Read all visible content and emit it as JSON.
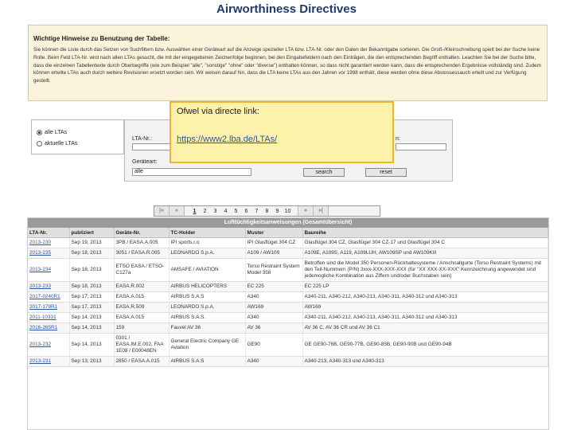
{
  "page": {
    "title": "Airworthiness Directives"
  },
  "hints": {
    "heading": "Wichtige Hinweise zu Benutzung der Tabelle:",
    "text": "Sie können die Liste durch das Setzen von Suchfiltern bzw. Auswählen einer Geräteart auf die Anzeige spezieller LTA bzw. LTA-Nr. oder den Daten der Bekanntgabe sortieren. Die Groß-/Kleinschreibung spielt bei der Suche keine Rolle. Beim Feld LTA-Nr. wird nach allen LTAs gesucht, die mit der eingegebenen Zeichenfolge beginnen, bei den Eingabefeldern nach den Einträgen, die den entsprechenden Begriff enthalten. Leachten Sie bei der Suche bitte, dass die einzelnen Tabellentexte durch Oberbegriffe (wie zum Beispiel \"alle\", \"sonstige\" \"ohne\" oder \"diverse\") enthalten können, so dass nicht garantiert werden kann, dass die entsprechenden Ergebnisse vollständig sind. Zudem können erteilte LTAs auch durch weitere Revisionen ersetzt worden sein. Wir weisen darauf hin, dass die LTA keine LTAs aus den Jahren vor 1998 enthält, diese werden ohne diese Abstossessauch erteilt und zur Verfügung gestellt."
  },
  "filter": {
    "opt_all": "alle LTAs",
    "opt_current": "aktuelle LTAs"
  },
  "search": {
    "lta_label": "LTA-Nr.:",
    "extra_label": "n:",
    "device_label": "Geräteart:",
    "device_value": "alle",
    "search_btn": "search",
    "reset_btn": "reset"
  },
  "popup": {
    "line1": "Ofwel via directe link:",
    "link": "https://www2.lba.de/LTAs/"
  },
  "pager": {
    "first": "|«",
    "prev": "«",
    "pages": [
      "1",
      "2",
      "3",
      "4",
      "5",
      "6",
      "7",
      "8",
      "9",
      "10"
    ],
    "current": "1",
    "next": "»",
    "last": "»|"
  },
  "table": {
    "caption": "Lufttüchtigkeitsanweisungen (Gesamtübersicht)",
    "headers": [
      "LTA-Nr.",
      "publiziert",
      "Geräte-Nr.",
      "TC-Holder",
      "Muster",
      "Baureihe"
    ],
    "rows": [
      [
        "2013-230",
        "Sep 19, 2013",
        "3PB / EASA.A.005",
        "IPI sports.r.o",
        "IPI Glasflügel 304 CZ",
        "Glasflügel 304 CZ, Glasflügel 304 CZ-17 und Glasflügel 304 C"
      ],
      [
        "2013-235",
        "Sep 18, 2013",
        "3051 / EASA.R.005",
        "LEONARDO S.p.A.",
        "A109 / AW109",
        "A109E, A109S, A119, A109LUH, AW109SP und AW109Kill"
      ],
      [
        "2013-234",
        "Sep 18, 2013",
        "ETSO EASA / ETSO-C127a",
        "AMSAFE / AVIATION",
        "Torso Restraint System Model 358",
        "Betroffen sind die Model 350 Personen-Rückhaltesysteme / Anschnallgurte (Torso Restraint Systems) mit den Teil-Nummern (P/N) 3xxx-XXX-XXX-XXX (für \"XX XXX-XX-XXX\" Kennzeichnung angewendet sind jedemogliche Kombination aus Ziffern und/oder Buchstaben sein)"
      ],
      [
        "2013-233",
        "Sep 18, 2013",
        "EASA.R.002",
        "AIRBUS HELICOPTERS",
        "EC 225",
        "EC 225 LP"
      ],
      [
        "2017-0240R1",
        "Sep 17, 2013",
        "EASA.A.015",
        "AIRBUS S.A.S",
        "A340",
        "A340-211, A340-212, A340-213, A340-311, A340-312 und A340-313"
      ],
      [
        "2017-179R1",
        "Sep 17, 2013",
        "EASA.R.509",
        "LEONARDO S.p.A.",
        "AW169",
        "AW169"
      ],
      [
        "2011-10331",
        "Sep 14, 2013",
        "EASA.A.015",
        "AIRBUS S.A.S.",
        "A340",
        "A340-211, A340-212, A340-213, A340-311, A340-312 und A340-313"
      ],
      [
        "2016-265R1",
        "Sep 14, 2013",
        "159",
        "Fauvel AV 36",
        "AV 36",
        "AV 36 C, AV 36 CR und AV 36 C1"
      ],
      [
        "2013-232",
        "Sep 14, 2013",
        "0301 / EASA.IM.E.002, FAA 1E08 / E00048EN",
        "General Electric Company GE Aviation",
        "GE90",
        "GE GE90-76B, GE90-77B, GE90-85B, GE90-90B und GE90-94B"
      ],
      [
        "2013-231",
        "Sep 13, 2013",
        "2850 / EASA.A.015",
        "AIRBUS S.A.S",
        "A340",
        "A340-213, A340-313 und A340-313"
      ]
    ]
  }
}
